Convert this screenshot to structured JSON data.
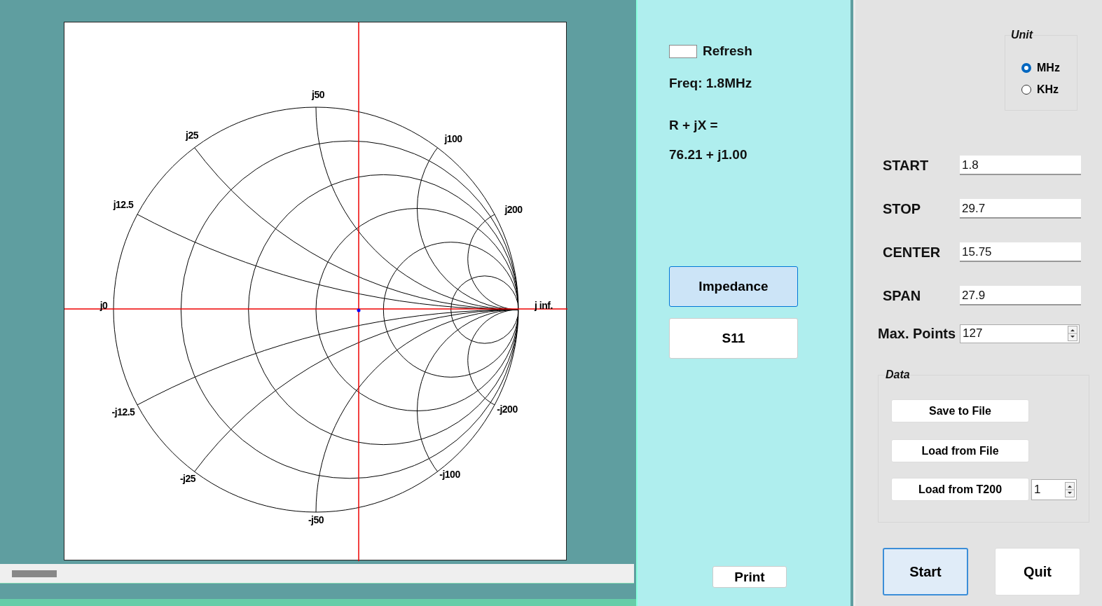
{
  "chart": {
    "labels": [
      {
        "text": "j50"
      },
      {
        "text": "j25"
      },
      {
        "text": "j100"
      },
      {
        "text": "j12.5"
      },
      {
        "text": "j200"
      },
      {
        "text": "j0"
      },
      {
        "text": "j inf."
      },
      {
        "text": "-j12.5"
      },
      {
        "text": "-j200"
      },
      {
        "text": "-j25"
      },
      {
        "text": "-j100"
      },
      {
        "text": "-j50"
      }
    ]
  },
  "refresh": {
    "label": "Refresh"
  },
  "freq": "Freq:  1.8MHz",
  "impedance_label": "R + jX =",
  "impedance_value": "76.21 + j1.00",
  "modes": [
    {
      "label": "Impedance",
      "selected": true
    },
    {
      "label": "S11",
      "selected": false
    }
  ],
  "print": "Print",
  "unit": {
    "title": "Unit",
    "options": [
      {
        "label": "MHz",
        "selected": true
      },
      {
        "label": "KHz",
        "selected": false
      }
    ]
  },
  "sweep": [
    {
      "label": "START",
      "value": "1.8"
    },
    {
      "label": "STOP",
      "value": "29.7"
    },
    {
      "label": "CENTER",
      "value": "15.75"
    },
    {
      "label": "SPAN",
      "value": "27.9"
    }
  ],
  "max_points": {
    "label": "Max. Points",
    "value": "127"
  },
  "data": {
    "title": "Data",
    "buttons": [
      "Save to File",
      "Load from File"
    ],
    "t200": {
      "label": "Load from T200",
      "value": "1"
    }
  },
  "actions": [
    {
      "label": "Start",
      "focused": true
    },
    {
      "label": "Quit",
      "focused": false
    }
  ]
}
